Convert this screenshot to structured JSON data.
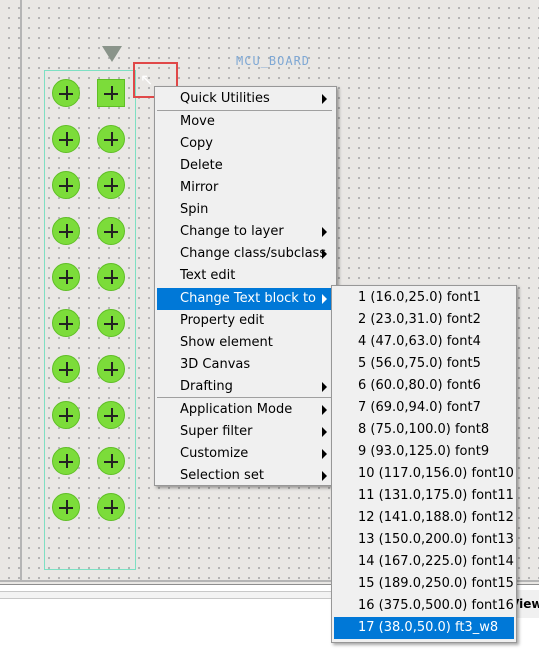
{
  "board": {
    "ref_label": "MCU_BOARD",
    "pad_color": "#7cdc3a",
    "outline_color": "#7de0c3",
    "selection_color": "#e04848"
  },
  "view_tab_label": "View",
  "context_menu": {
    "items": [
      {
        "label": "Quick Utilities",
        "submenu": true
      },
      {
        "label": "Move",
        "submenu": false
      },
      {
        "label": "Copy",
        "submenu": false
      },
      {
        "label": "Delete",
        "submenu": false
      },
      {
        "label": "Mirror",
        "submenu": false
      },
      {
        "label": "Spin",
        "submenu": false
      },
      {
        "label": "Change to layer",
        "submenu": true
      },
      {
        "label": "Change class/subclass",
        "submenu": true
      },
      {
        "label": "Text edit",
        "submenu": false
      },
      {
        "label": "Change Text block to",
        "submenu": true,
        "highlighted": true
      },
      {
        "label": "Property edit",
        "submenu": false
      },
      {
        "label": "Show element",
        "submenu": false
      },
      {
        "label": "3D Canvas",
        "submenu": false
      },
      {
        "label": "Drafting",
        "submenu": true
      },
      {
        "label": "Application Mode",
        "submenu": true
      },
      {
        "label": "Super filter",
        "submenu": true
      },
      {
        "label": "Customize",
        "submenu": true
      },
      {
        "label": "Selection set",
        "submenu": true
      }
    ]
  },
  "text_block_submenu": {
    "items": [
      "1 (16.0,25.0) font1",
      "2 (23.0,31.0) font2",
      "4 (47.0,63.0) font4",
      "5 (56.0,75.0) font5",
      "6 (60.0,80.0) font6",
      "7 (69.0,94.0) font7",
      "8 (75.0,100.0) font8",
      "9 (93.0,125.0) font9",
      "10 (117.0,156.0) font10",
      "11 (131.0,175.0) font11",
      "12 (141.0,188.0) font12",
      "13 (150.0,200.0) font13",
      "14 (167.0,225.0) font14",
      "15 (189.0,250.0) font15",
      "16 (375.0,500.0) font16",
      "17 (38.0,50.0) ft3_w8"
    ],
    "highlighted_index": 15
  },
  "colors": {
    "menu_highlight": "#0078d7",
    "canvas_background": "#e9e7e4"
  }
}
